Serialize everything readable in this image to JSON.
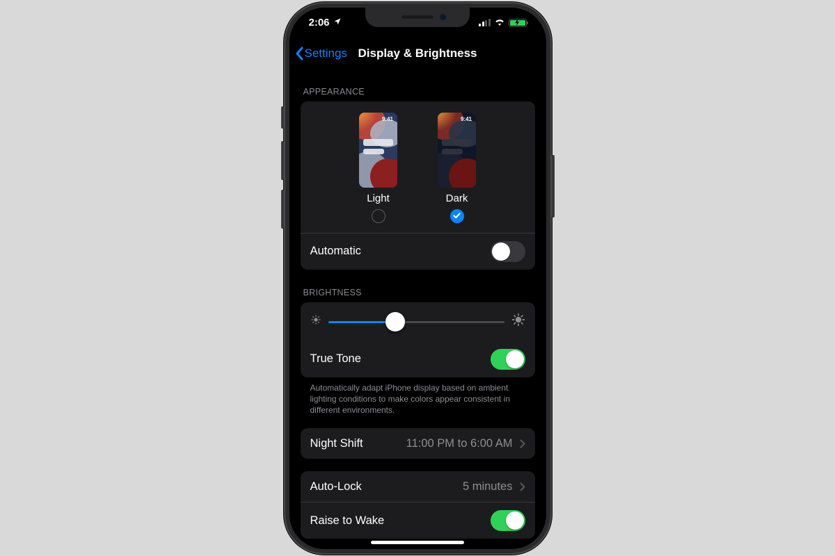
{
  "status": {
    "time": "2:06"
  },
  "nav": {
    "back": "Settings",
    "title": "Display & Brightness"
  },
  "appearance": {
    "header": "APPEARANCE",
    "light_label": "Light",
    "dark_label": "Dark",
    "preview_time": "9:41",
    "selected": "dark",
    "automatic_label": "Automatic",
    "automatic_on": false
  },
  "brightness": {
    "header": "BRIGHTNESS",
    "value_pct": 38,
    "truetone_label": "True Tone",
    "truetone_on": true,
    "truetone_note": "Automatically adapt iPhone display based on ambient lighting conditions to make colors appear consistent in different environments."
  },
  "nightshift": {
    "label": "Night Shift",
    "value": "11:00 PM to 6:00 AM"
  },
  "autolock": {
    "label": "Auto-Lock",
    "value": "5 minutes"
  },
  "raise": {
    "label": "Raise to Wake",
    "on": true
  }
}
